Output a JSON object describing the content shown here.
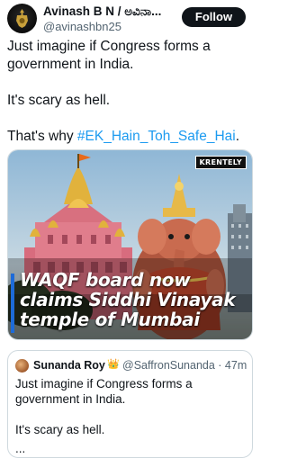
{
  "post": {
    "author_name": "Avinash B N / ಅವಿನಾ...",
    "author_handle": "@avinashbn25",
    "follow_label": "Follow",
    "text_line1": "Just imagine if Congress forms a government in India.",
    "text_line2": "It's scary as hell.",
    "text_prefix": "That's why ",
    "hashtag": "#EK_Hain_Toh_Safe_Hai",
    "text_suffix": "."
  },
  "media": {
    "brand": "KRENTELY",
    "caption_line1": "WAQF board now",
    "caption_line2": "claims Siddhi Vinayak",
    "caption_line3": "temple of Mumbai"
  },
  "quoted_post": {
    "author_name": "Sunanda Roy",
    "badge": "👑",
    "handle_time": "@SaffronSunanda · 47m",
    "text_line1": "Just imagine if Congress forms a government in India.",
    "text_line2": "It's scary as hell.",
    "text_line3": "..."
  },
  "colors": {
    "accent": "#1d9bf0",
    "follow_bg": "#0f1419",
    "caption_blue": "#4fa3ff"
  }
}
